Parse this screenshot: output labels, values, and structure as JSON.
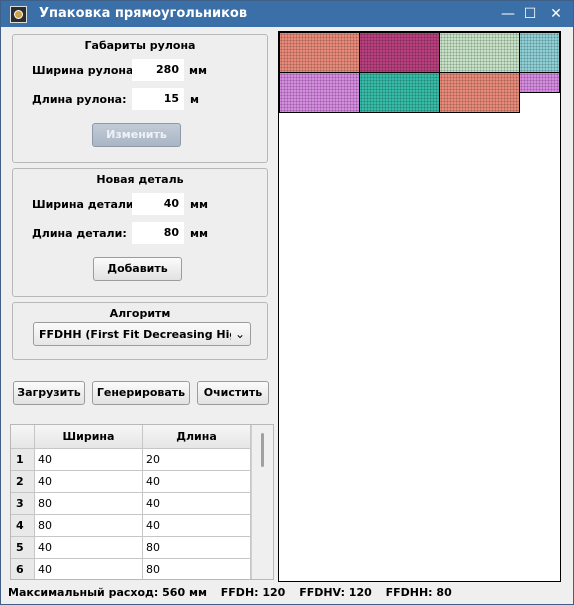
{
  "window": {
    "title": "Упаковка прямоугольников"
  },
  "titlebar_buttons": {
    "minimize": "—",
    "maximize": "☐",
    "close": "✕"
  },
  "roll_group": {
    "title": "Габариты рулона",
    "width_label": "Ширина рулона:",
    "width_value": "280",
    "width_unit": "мм",
    "length_label": "Длина рулона:",
    "length_value": "15",
    "length_unit": "м",
    "change_button": "Изменить"
  },
  "part_group": {
    "title": "Новая деталь",
    "width_label": "Ширина детали:",
    "width_value": "40",
    "width_unit": "мм",
    "length_label": "Длина детали:",
    "length_value": "80",
    "length_unit": "мм",
    "add_button": "Добавить"
  },
  "algorithm_group": {
    "title": "Алгоритм",
    "selected": "FFDHH (First Fit Decreasing High Horizontal)"
  },
  "actions": {
    "load": "Загрузить",
    "generate": "Генерировать",
    "clear": "Очистить"
  },
  "table": {
    "headers": [
      "Ширина",
      "Длина"
    ],
    "rows": [
      {
        "n": "1",
        "width": "40",
        "length": "20"
      },
      {
        "n": "2",
        "width": "40",
        "length": "40"
      },
      {
        "n": "3",
        "width": "80",
        "length": "40"
      },
      {
        "n": "4",
        "width": "80",
        "length": "40"
      },
      {
        "n": "5",
        "width": "40",
        "length": "80"
      },
      {
        "n": "6",
        "width": "40",
        "length": "80"
      }
    ]
  },
  "packing": {
    "colors": [
      "#e88a7a",
      "#b8407e",
      "#c6e2c6",
      "#8ecfd6",
      "#d58be0",
      "#36bba8",
      "#e88a7a",
      "#d58be0"
    ]
  },
  "status": {
    "max_usage": "Максимальный расход: 560 мм",
    "ffdh": "FFDH: 120",
    "ffdhv": "FFDHV: 120",
    "ffdhh": "FFDHH: 80"
  }
}
